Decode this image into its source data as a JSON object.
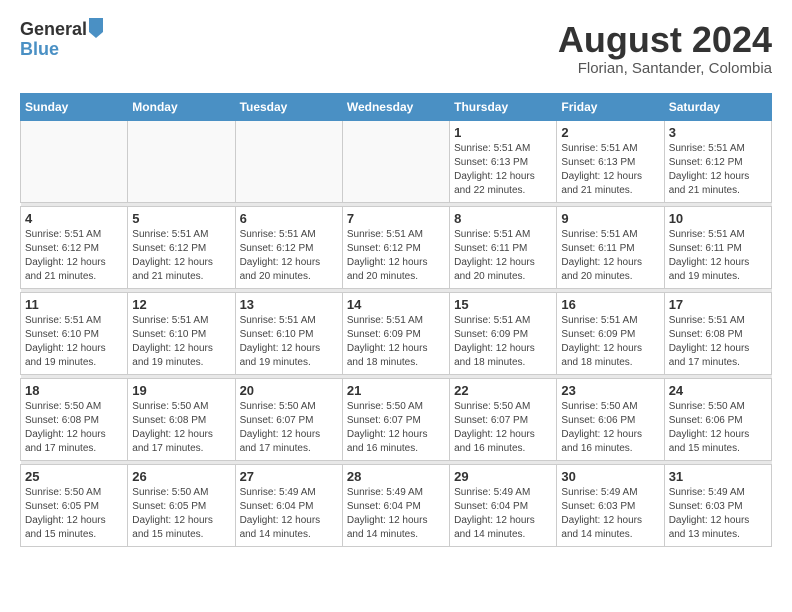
{
  "header": {
    "logo_line1": "General",
    "logo_line2": "Blue",
    "month_year": "August 2024",
    "location": "Florian, Santander, Colombia"
  },
  "weekdays": [
    "Sunday",
    "Monday",
    "Tuesday",
    "Wednesday",
    "Thursday",
    "Friday",
    "Saturday"
  ],
  "weeks": [
    [
      {
        "day": "",
        "info": ""
      },
      {
        "day": "",
        "info": ""
      },
      {
        "day": "",
        "info": ""
      },
      {
        "day": "",
        "info": ""
      },
      {
        "day": "1",
        "info": "Sunrise: 5:51 AM\nSunset: 6:13 PM\nDaylight: 12 hours\nand 22 minutes."
      },
      {
        "day": "2",
        "info": "Sunrise: 5:51 AM\nSunset: 6:13 PM\nDaylight: 12 hours\nand 21 minutes."
      },
      {
        "day": "3",
        "info": "Sunrise: 5:51 AM\nSunset: 6:12 PM\nDaylight: 12 hours\nand 21 minutes."
      }
    ],
    [
      {
        "day": "4",
        "info": "Sunrise: 5:51 AM\nSunset: 6:12 PM\nDaylight: 12 hours\nand 21 minutes."
      },
      {
        "day": "5",
        "info": "Sunrise: 5:51 AM\nSunset: 6:12 PM\nDaylight: 12 hours\nand 21 minutes."
      },
      {
        "day": "6",
        "info": "Sunrise: 5:51 AM\nSunset: 6:12 PM\nDaylight: 12 hours\nand 20 minutes."
      },
      {
        "day": "7",
        "info": "Sunrise: 5:51 AM\nSunset: 6:12 PM\nDaylight: 12 hours\nand 20 minutes."
      },
      {
        "day": "8",
        "info": "Sunrise: 5:51 AM\nSunset: 6:11 PM\nDaylight: 12 hours\nand 20 minutes."
      },
      {
        "day": "9",
        "info": "Sunrise: 5:51 AM\nSunset: 6:11 PM\nDaylight: 12 hours\nand 20 minutes."
      },
      {
        "day": "10",
        "info": "Sunrise: 5:51 AM\nSunset: 6:11 PM\nDaylight: 12 hours\nand 19 minutes."
      }
    ],
    [
      {
        "day": "11",
        "info": "Sunrise: 5:51 AM\nSunset: 6:10 PM\nDaylight: 12 hours\nand 19 minutes."
      },
      {
        "day": "12",
        "info": "Sunrise: 5:51 AM\nSunset: 6:10 PM\nDaylight: 12 hours\nand 19 minutes."
      },
      {
        "day": "13",
        "info": "Sunrise: 5:51 AM\nSunset: 6:10 PM\nDaylight: 12 hours\nand 19 minutes."
      },
      {
        "day": "14",
        "info": "Sunrise: 5:51 AM\nSunset: 6:09 PM\nDaylight: 12 hours\nand 18 minutes."
      },
      {
        "day": "15",
        "info": "Sunrise: 5:51 AM\nSunset: 6:09 PM\nDaylight: 12 hours\nand 18 minutes."
      },
      {
        "day": "16",
        "info": "Sunrise: 5:51 AM\nSunset: 6:09 PM\nDaylight: 12 hours\nand 18 minutes."
      },
      {
        "day": "17",
        "info": "Sunrise: 5:51 AM\nSunset: 6:08 PM\nDaylight: 12 hours\nand 17 minutes."
      }
    ],
    [
      {
        "day": "18",
        "info": "Sunrise: 5:50 AM\nSunset: 6:08 PM\nDaylight: 12 hours\nand 17 minutes."
      },
      {
        "day": "19",
        "info": "Sunrise: 5:50 AM\nSunset: 6:08 PM\nDaylight: 12 hours\nand 17 minutes."
      },
      {
        "day": "20",
        "info": "Sunrise: 5:50 AM\nSunset: 6:07 PM\nDaylight: 12 hours\nand 17 minutes."
      },
      {
        "day": "21",
        "info": "Sunrise: 5:50 AM\nSunset: 6:07 PM\nDaylight: 12 hours\nand 16 minutes."
      },
      {
        "day": "22",
        "info": "Sunrise: 5:50 AM\nSunset: 6:07 PM\nDaylight: 12 hours\nand 16 minutes."
      },
      {
        "day": "23",
        "info": "Sunrise: 5:50 AM\nSunset: 6:06 PM\nDaylight: 12 hours\nand 16 minutes."
      },
      {
        "day": "24",
        "info": "Sunrise: 5:50 AM\nSunset: 6:06 PM\nDaylight: 12 hours\nand 15 minutes."
      }
    ],
    [
      {
        "day": "25",
        "info": "Sunrise: 5:50 AM\nSunset: 6:05 PM\nDaylight: 12 hours\nand 15 minutes."
      },
      {
        "day": "26",
        "info": "Sunrise: 5:50 AM\nSunset: 6:05 PM\nDaylight: 12 hours\nand 15 minutes."
      },
      {
        "day": "27",
        "info": "Sunrise: 5:49 AM\nSunset: 6:04 PM\nDaylight: 12 hours\nand 14 minutes."
      },
      {
        "day": "28",
        "info": "Sunrise: 5:49 AM\nSunset: 6:04 PM\nDaylight: 12 hours\nand 14 minutes."
      },
      {
        "day": "29",
        "info": "Sunrise: 5:49 AM\nSunset: 6:04 PM\nDaylight: 12 hours\nand 14 minutes."
      },
      {
        "day": "30",
        "info": "Sunrise: 5:49 AM\nSunset: 6:03 PM\nDaylight: 12 hours\nand 14 minutes."
      },
      {
        "day": "31",
        "info": "Sunrise: 5:49 AM\nSunset: 6:03 PM\nDaylight: 12 hours\nand 13 minutes."
      }
    ]
  ]
}
